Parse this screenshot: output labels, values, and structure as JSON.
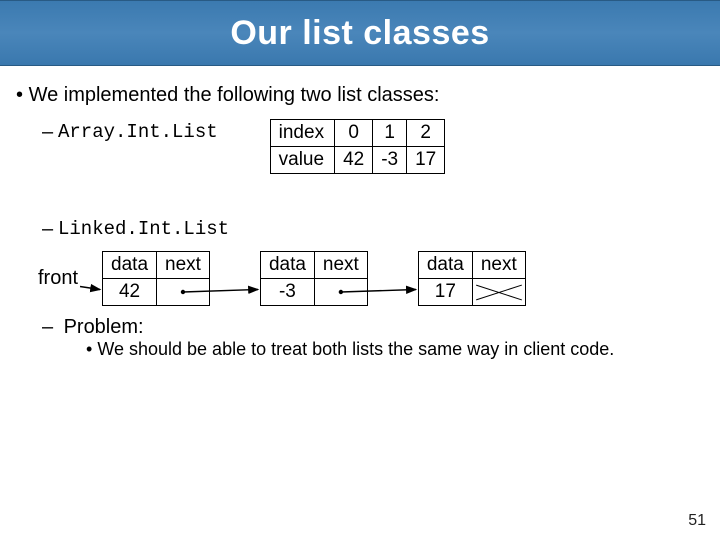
{
  "title": "Our list classes",
  "bullets": {
    "main": "We implemented the following two list classes:"
  },
  "array_list": {
    "name": "Array.Int.List",
    "rows": [
      "index",
      "value"
    ],
    "indices": [
      "0",
      "1",
      "2"
    ],
    "values": [
      "42",
      "-3",
      "17"
    ]
  },
  "linked_list": {
    "name": "Linked.Int.List",
    "front_label": "front",
    "headers": [
      "data",
      "next"
    ],
    "nodes": [
      {
        "data": "42"
      },
      {
        "data": "-3"
      },
      {
        "data": "17"
      }
    ]
  },
  "problem": {
    "label": "Problem:",
    "detail": "We should be able to treat both lists the same way in client code."
  },
  "page_number": "51"
}
